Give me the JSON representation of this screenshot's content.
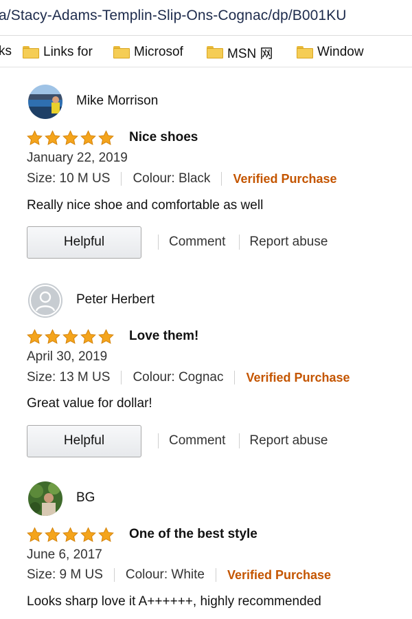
{
  "browser": {
    "url": "a/Stacy-Adams-Templin-Slip-Ons-Cognac/dp/B001KU",
    "bookmarks_lead": "ks",
    "bookmarks": [
      {
        "label": "Links for",
        "icon": "folder-icon"
      },
      {
        "label": "Microsof",
        "icon": "folder-icon"
      },
      {
        "label": "MSN 网",
        "icon": "folder-icon"
      },
      {
        "label": "Window",
        "icon": "folder-icon"
      }
    ]
  },
  "colors": {
    "star": "#f4a41c",
    "verified": "#c45500",
    "folder": "#f5cd55"
  },
  "reviews": [
    {
      "name": "Mike Morrison",
      "avatar": "landscape-photo",
      "rating": 5,
      "title": "Nice shoes",
      "date": "January 22, 2019",
      "size": "Size: 10 M US",
      "colour": "Colour: Black",
      "verified": "Verified Purchase",
      "body": "Really nice shoe and comfortable as well",
      "helpful_label": "Helpful",
      "comment_label": "Comment",
      "report_label": "Report abuse"
    },
    {
      "name": "Peter Herbert",
      "avatar": "default-user-icon",
      "rating": 5,
      "title": "Love them!",
      "date": "April 30, 2019",
      "size": "Size: 13 M US",
      "colour": "Colour: Cognac",
      "verified": "Verified Purchase",
      "body": "Great value for dollar!",
      "helpful_label": "Helpful",
      "comment_label": "Comment",
      "report_label": "Report abuse"
    },
    {
      "name": "BG",
      "avatar": "person-photo",
      "rating": 5,
      "title": "One of the best style",
      "date": "June 6, 2017",
      "size": "Size: 9 M US",
      "colour": "Colour: White",
      "verified": "Verified Purchase",
      "body": "Looks sharp love it A++++++, highly recommended"
    }
  ]
}
